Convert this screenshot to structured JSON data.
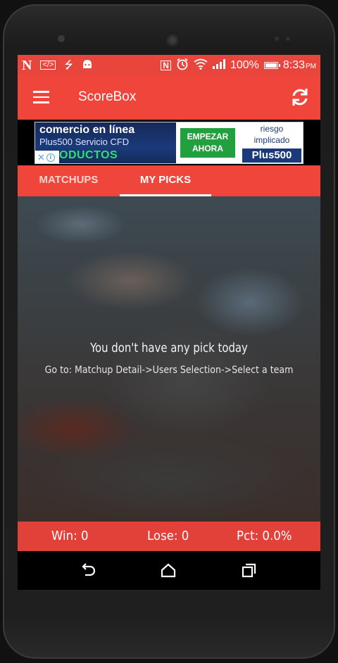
{
  "status_bar": {
    "battery_percent": "100%",
    "time": "8:33",
    "ampm": "PM",
    "icons": [
      "netflix-icon",
      "code-icon",
      "usb-icon",
      "android-icon",
      "nfc-icon",
      "alarm-icon",
      "wifi-icon",
      "signal-icon",
      "battery-icon"
    ]
  },
  "toolbar": {
    "title": "ScoreBox",
    "menu_icon": "hamburger-menu-icon",
    "refresh_icon": "refresh-icon"
  },
  "ad": {
    "headline": "comercio en línea",
    "subline": "Plus500 Servicio CFD",
    "product_line": "ODUCTOS",
    "cta_line1": "EMPEZAR",
    "cta_line2": "AHORA",
    "risk_line1": "riesgo",
    "risk_line2": "implicado",
    "brand": "Plus500"
  },
  "tabs": [
    {
      "label": "MATCHUPS",
      "selected": false
    },
    {
      "label": "MY PICKS",
      "selected": true
    }
  ],
  "content": {
    "empty_title": "You don't have any pick today",
    "empty_hint": "Go to: Matchup Detail->Users Selection->Select a team"
  },
  "stats": {
    "win": "Win: 0",
    "lose": "Lose: 0",
    "pct": "Pct: 0.0%"
  },
  "colors": {
    "primary": "#f0453b",
    "status_bar": "#e8453c",
    "stats_bar": "#e2413a"
  }
}
